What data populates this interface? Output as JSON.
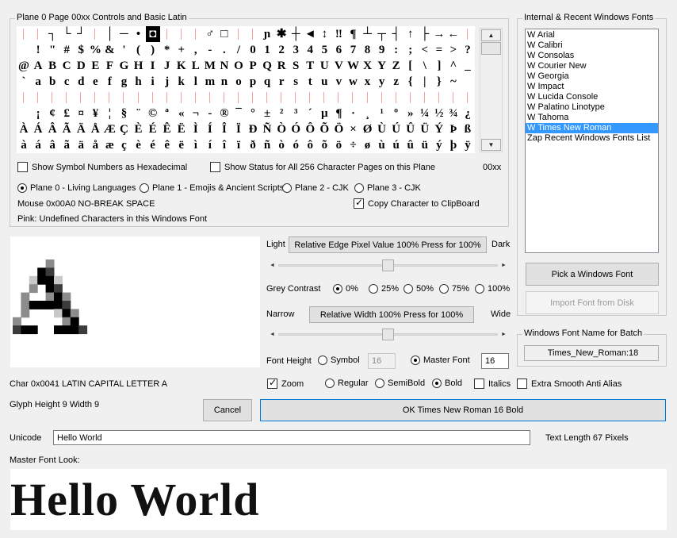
{
  "charpage": {
    "legend": "Plane 0  Page 00xx   Controls and Basic Latin",
    "page_label": "00xx",
    "rows": [
      [
        "",
        "",
        "┐",
        "└",
        "┘",
        "",
        "│",
        "─",
        "•",
        "◘",
        "",
        "",
        "",
        "♂",
        "□",
        "",
        "",
        "ɲ",
        "✱",
        "┼",
        "◄",
        "↕",
        "‼",
        "¶",
        "┴",
        "┬",
        "┤",
        "↑",
        "├",
        "→",
        "←",
        ""
      ],
      [
        "",
        "!",
        "\"",
        "#",
        "$",
        "%",
        "&",
        "'",
        "(",
        ")",
        "*",
        "+",
        ",",
        "-",
        ".",
        "/",
        "0",
        "1",
        "2",
        "3",
        "4",
        "5",
        "6",
        "7",
        "8",
        "9",
        ":",
        ";",
        "<",
        "=",
        ">",
        "?"
      ],
      [
        "@",
        "A",
        "B",
        "C",
        "D",
        "E",
        "F",
        "G",
        "H",
        "I",
        "J",
        "K",
        "L",
        "M",
        "N",
        "O",
        "P",
        "Q",
        "R",
        "S",
        "T",
        "U",
        "V",
        "W",
        "X",
        "Y",
        "Z",
        "[",
        "\\",
        "]",
        "^",
        "_"
      ],
      [
        "`",
        "a",
        "b",
        "c",
        "d",
        "e",
        "f",
        "g",
        "h",
        "i",
        "j",
        "k",
        "l",
        "m",
        "n",
        "o",
        "p",
        "q",
        "r",
        "s",
        "t",
        "u",
        "v",
        "w",
        "x",
        "y",
        "z",
        "{",
        "|",
        "}",
        "~",
        ""
      ],
      [
        "",
        "",
        "",
        "",
        "",
        "",
        "",
        "",
        "",
        "",
        "",
        "",
        "",
        "",
        "",
        "",
        "",
        "",
        "",
        "",
        "",
        "",
        "",
        "",
        "",
        "",
        "",
        "",
        "",
        "",
        "",
        ""
      ],
      [
        "",
        "¡",
        "¢",
        "£",
        "¤",
        "¥",
        "¦",
        "§",
        "¨",
        "©",
        "ª",
        "«",
        "¬",
        "-",
        "®",
        "¯",
        "°",
        "±",
        "²",
        "³",
        "´",
        "µ",
        "¶",
        "·",
        "¸",
        "¹",
        "º",
        "»",
        "¼",
        "½",
        "¾",
        "¿"
      ],
      [
        "À",
        "Á",
        "Â",
        "Ã",
        "Ä",
        "Å",
        "Æ",
        "Ç",
        "È",
        "É",
        "Ê",
        "Ë",
        "Ì",
        "Í",
        "Î",
        "Ï",
        "Ð",
        "Ñ",
        "Ò",
        "Ó",
        "Ô",
        "Õ",
        "Ö",
        "×",
        "Ø",
        "Ù",
        "Ú",
        "Û",
        "Ü",
        "Ý",
        "Þ",
        "ß"
      ],
      [
        "à",
        "á",
        "â",
        "ã",
        "ä",
        "å",
        "æ",
        "ç",
        "è",
        "é",
        "ê",
        "ë",
        "ì",
        "í",
        "î",
        "ï",
        "ð",
        "ñ",
        "ò",
        "ó",
        "ô",
        "õ",
        "ö",
        "÷",
        "ø",
        "ù",
        "ú",
        "û",
        "ü",
        "ý",
        "þ",
        "ÿ"
      ]
    ],
    "show_hex_label": "Show Symbol Numbers as Hexadecimal",
    "show_hex_checked": false,
    "show_status_label": "Show Status for All 256 Character Pages on this Plane",
    "show_status_checked": false,
    "planes": [
      {
        "label": "Plane 0 - Living Languages",
        "selected": true
      },
      {
        "label": "Plane 1 - Emojis & Ancient Scripts",
        "selected": false
      },
      {
        "label": "Plane 2 - CJK",
        "selected": false
      },
      {
        "label": "Plane 3 - CJK",
        "selected": false
      }
    ],
    "mouse_status": "Mouse 0x00A0  NO-BREAK SPACE",
    "copy_label": "Copy Character to ClipBoard",
    "copy_checked": true,
    "pink_note": "Pink: Undefined Characters in this Windows Font"
  },
  "fonts": {
    "legend": "Internal & Recent Windows Fonts",
    "items": [
      "W  Arial",
      "W  Calibri",
      "W  Consolas",
      "W  Courier New",
      "W  Georgia",
      "W  Impact",
      "W  Lucida Console",
      "W  Palatino Linotype",
      "W  Tahoma",
      "W  Times New Roman",
      "Zap Recent Windows Fonts List"
    ],
    "selected_index": 9,
    "pick_button": "Pick a Windows Font",
    "import_button": "Import Font from Disk",
    "batch_legend": "Windows Font Name for Batch",
    "batch_name": "Times_New_Roman:18"
  },
  "controls": {
    "light_label": "Light",
    "edge_button": "Relative Edge Pixel Value 100%   Press for 100%",
    "dark_label": "Dark",
    "edge_slider": 0.5,
    "grey_label": "Grey Contrast",
    "grey_options": [
      {
        "label": "0%",
        "selected": true
      },
      {
        "label": "25%",
        "selected": false
      },
      {
        "label": "50%",
        "selected": false
      },
      {
        "label": "75%",
        "selected": false
      },
      {
        "label": "100%",
        "selected": false
      }
    ],
    "narrow_label": "Narrow",
    "width_button": "Relative Width 100%   Press for 100%",
    "wide_label": "Wide",
    "width_slider": 0.5,
    "font_height_label": "Font Height",
    "symbol_label": "Symbol",
    "symbol_selected": false,
    "symbol_value": "16",
    "master_label": "Master Font",
    "master_selected": true,
    "master_value": "16",
    "zoom_label": "Zoom",
    "zoom_checked": true,
    "weights": [
      {
        "label": "Regular",
        "selected": false
      },
      {
        "label": "SemiBold",
        "selected": false
      },
      {
        "label": "Bold",
        "selected": true
      }
    ],
    "italics_label": "Italics",
    "italics_checked": false,
    "smooth_label": "Extra Smooth Anti Alias",
    "smooth_checked": false,
    "cancel_button": "Cancel",
    "ok_button": "OK    Times New Roman 16 Bold"
  },
  "glyph": {
    "preview_char": "A",
    "char_info": "Char 0x0041  LATIN CAPITAL LETTER A",
    "glyph_info": "Glyph  Height 9  Width 9"
  },
  "text": {
    "unicode_label": "Unicode",
    "unicode_value": "Hello World",
    "text_length": "Text Length  67  Pixels",
    "master_look_label": "Master Font Look:",
    "preview_text": "Hello World"
  },
  "colors": {
    "selection": "#3399ff",
    "undefined_marker": "#f4a0a0"
  }
}
